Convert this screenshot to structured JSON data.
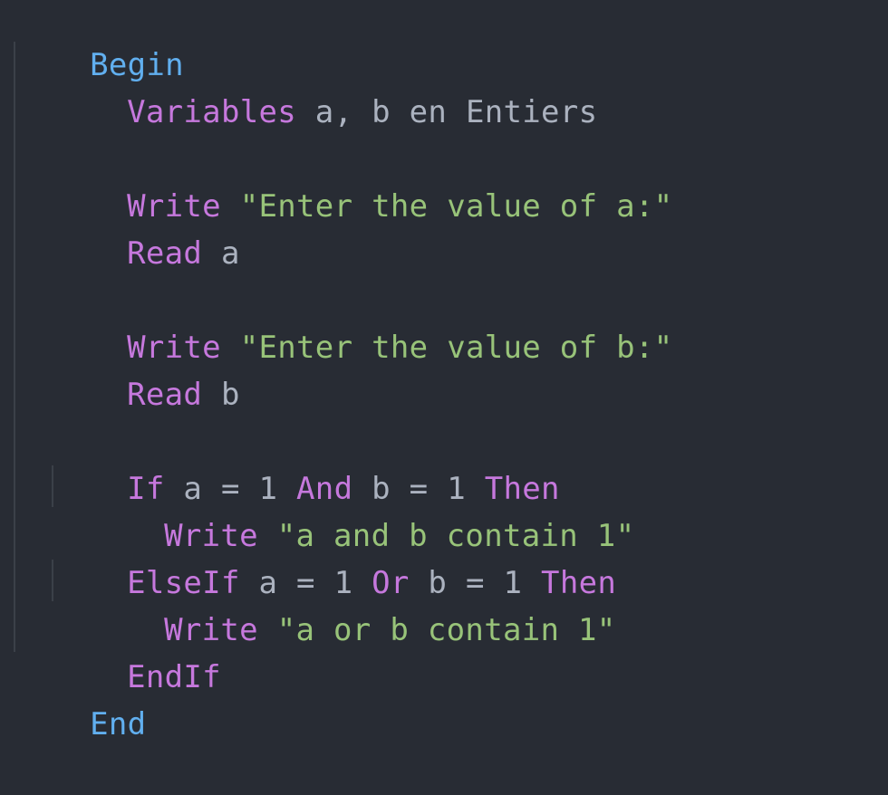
{
  "code": {
    "begin": "Begin",
    "l_var_kw": "Variables",
    "l_var_rest": " a, b en Entiers",
    "l_write1_kw": "Write",
    "l_write1_str": " \"Enter the value of a:\"",
    "l_read1_kw": "Read",
    "l_read1_var": " a",
    "l_write2_kw": "Write",
    "l_write2_str": " \"Enter the value of b:\"",
    "l_read2_kw": "Read",
    "l_read2_var": " b",
    "if_kw": "If",
    "if_cond1": " a = 1 ",
    "and_kw": "And",
    "if_cond2": " b = 1 ",
    "then1_kw": "Then",
    "w3_kw": "Write",
    "w3_str": " \"a and b contain 1\"",
    "elseif_kw": "ElseIf",
    "elseif_cond1": " a = 1 ",
    "or_kw": "Or",
    "elseif_cond2": " b = 1 ",
    "then2_kw": "Then",
    "w4_kw": "Write",
    "w4_str": " \"a or b contain 1\"",
    "endif_kw": "EndIf",
    "end": "End"
  },
  "colors": {
    "background": "#282c34",
    "block_keyword": "#61afef",
    "keyword": "#c678dd",
    "string": "#98c379",
    "identifier": "#abb2bf"
  }
}
